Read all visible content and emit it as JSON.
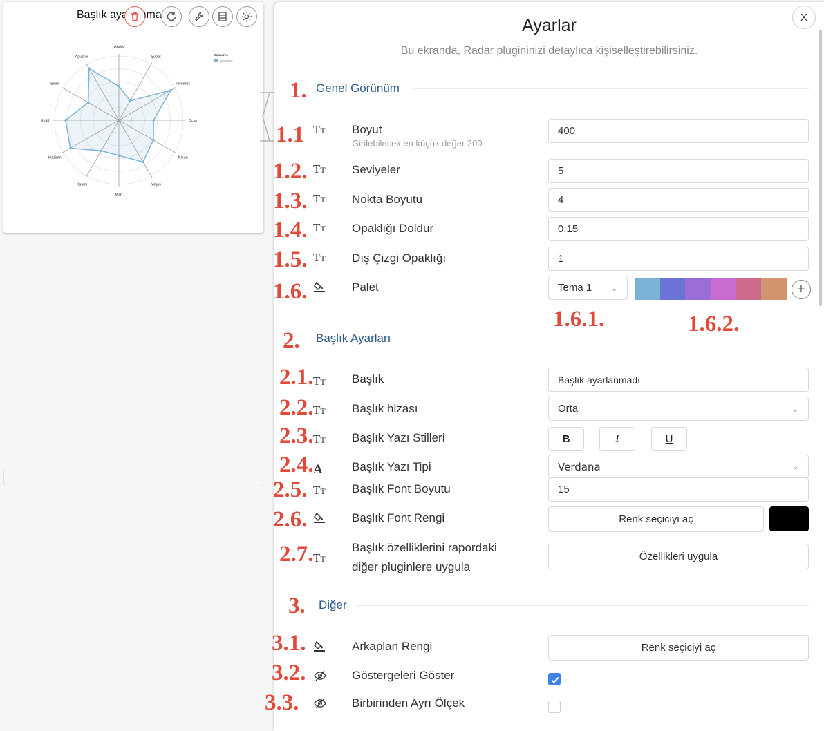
{
  "widget": {
    "title": "Başlık ayarlanmadı",
    "legend_title": "Measures",
    "legend_item": "polutoplam",
    "legend_color": "#7fb4d8"
  },
  "chart_data": {
    "type": "radar",
    "axes": [
      "Aralık",
      "Şubat",
      "Temmuz",
      "Ocak",
      "Nisan",
      "Mayıs",
      "Mart",
      "Kasım",
      "Haziran",
      "Eylül",
      "Ekim",
      "Ağustos"
    ],
    "series": [
      {
        "name": "polutoplam",
        "values": [
          0.53,
          0.35,
          0.93,
          0.54,
          0.62,
          0.75,
          0.55,
          0.55,
          0.87,
          0.83,
          0.55,
          0.93
        ]
      }
    ],
    "levels": 5,
    "fill_opacity": 0.15,
    "color": "#7fb4d8"
  },
  "panel": {
    "close": "X",
    "title": "Ayarlar",
    "subtitle": "Bu ekranda, Radar plugininizi detaylıca kişiselleştirebilirsiniz."
  },
  "sections": {
    "general": "Genel Görünüm",
    "title": "Başlık Ayarları",
    "other": "Diğer"
  },
  "numbers": {
    "s1": "1.",
    "s1_1": "1.1",
    "s1_2": "1.2.",
    "s1_3": "1.3.",
    "s1_4": "1.4.",
    "s1_5": "1.5.",
    "s1_6": "1.6.",
    "s1_6_1": "1.6.1.",
    "s1_6_2": "1.6.2.",
    "s2": "2.",
    "s2_1": "2.1.",
    "s2_2": "2.2.",
    "s2_3": "2.3.",
    "s2_4": "2.4.",
    "s2_5": "2.5.",
    "s2_6": "2.6.",
    "s2_7": "2.7.",
    "s3": "3.",
    "s3_1": "3.1.",
    "s3_2": "3.2.",
    "s3_3": "3.3."
  },
  "general": {
    "size_label": "Boyut",
    "size_hint": "Girilebilecek en küçük değer 200",
    "size_value": "400",
    "levels_label": "Seviyeler",
    "levels_value": "5",
    "dot_label": "Nokta Boyutu",
    "dot_value": "4",
    "fill_label": "Opaklığı Doldur",
    "fill_value": "0.15",
    "stroke_label": "Dış Çizgi Opaklığı",
    "stroke_value": "1",
    "palette_label": "Palet",
    "palette_theme": "Tema 1",
    "palette_colors": [
      "#7bb3d6",
      "#6b73d6",
      "#9a6ed6",
      "#c96ccf",
      "#cd6b8a",
      "#d0946e"
    ]
  },
  "title_settings": {
    "title_label": "Başlık",
    "title_value": "Başlık ayarlanmadı",
    "align_label": "Başlık hizası",
    "align_value": "Orta",
    "styles_label": "Başlık Yazı Stilleri",
    "bold": "B",
    "italic": "I",
    "underline": "U",
    "font_label": "Başlık Yazı Tipi",
    "font_value": "Verdana",
    "font_size_label": "Başlık Font Boyutu",
    "font_size_value": "15",
    "font_color_label": "Başlık Font Rengi",
    "font_color_button": "Renk seçiciyi aç",
    "font_color": "#000000",
    "apply_label_1": "Başlık özelliklerini rapordaki",
    "apply_label_2": "diğer pluginlere uygula",
    "apply_button": "Özellikleri uygula"
  },
  "other": {
    "bg_label": "Arkaplan Rengi",
    "bg_button": "Renk seçiciyi aç",
    "legend_label": "Göstergeleri Göster",
    "legend_checked": true,
    "scale_label": "Birbirinden Ayrı Ölçek",
    "scale_checked": false,
    "check_color": "#3d84e6"
  }
}
